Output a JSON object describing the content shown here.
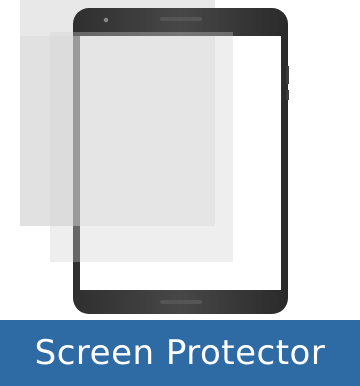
{
  "product": {
    "caption": "Screen Protector",
    "icon": "tablet-with-screen-protector-icon"
  },
  "colors": {
    "caption_background": "#2e6aa3",
    "caption_text": "#ffffff",
    "tablet_body": "#3a3a3a",
    "tablet_screen": "#ffffff",
    "protector_film": "#e8e8e8"
  }
}
